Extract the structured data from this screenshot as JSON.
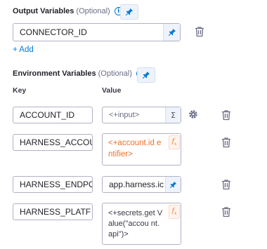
{
  "output_variables": {
    "title": "Output Variables",
    "optional_label": "(Optional)",
    "items": [
      {
        "value": "CONNECTOR_ID"
      }
    ],
    "add_label": "+ Add"
  },
  "environment_variables": {
    "title": "Environment Variables",
    "optional_label": "(Optional)",
    "key_header": "Key",
    "value_header": "Value",
    "rows": [
      {
        "key": "ACCOUNT_ID",
        "value": "<+input>",
        "value_type": "runtime-input"
      },
      {
        "key": "HARNESS_ACCOU",
        "value": "<+account.id entifier>",
        "value_type": "expression"
      },
      {
        "key": "HARNESS_ENDPO",
        "value": "app.harness.ic",
        "value_type": "fixed"
      },
      {
        "key": "HARNESS_PLATF",
        "value": "<+secrets.get Value(\"accou nt.api\")>",
        "value_type": "expression"
      }
    ]
  },
  "icons": {
    "info": "info-icon",
    "pin": "pin-icon",
    "delete": "trash-icon",
    "settings": "gear-icon",
    "expression": "fx-icon",
    "runtime": "sigma-icon"
  },
  "colors": {
    "accent_blue": "#0278d5",
    "expression_orange": "#f36f25",
    "border": "#b0b1c4"
  }
}
